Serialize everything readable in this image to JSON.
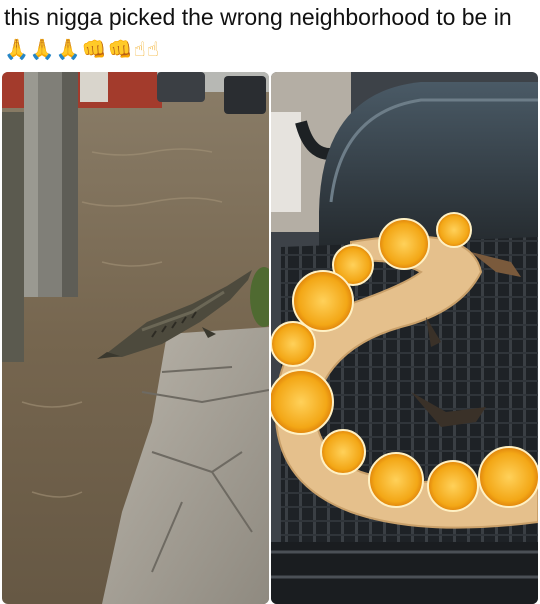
{
  "caption": {
    "text": "this nigga picked the wrong neighborhood to be in",
    "emojis": "🙏🙏🙏👊👊☝☝",
    "emoji_names": [
      "folded-hands-icon",
      "folded-hands-icon",
      "folded-hands-icon",
      "oncoming-fist-icon",
      "oncoming-fist-icon",
      "index-pointing-up-icon",
      "index-pointing-up-icon"
    ]
  },
  "photos": {
    "left": "crocodile-in-flooded-street",
    "right": "crocodile-on-grill-with-orange-slices"
  },
  "colors": {
    "water": "#7a6a55",
    "croc": "#4d4a3d",
    "grill": "#2d3135",
    "orange": "#f6b21b",
    "meat": "#e5c08c"
  }
}
